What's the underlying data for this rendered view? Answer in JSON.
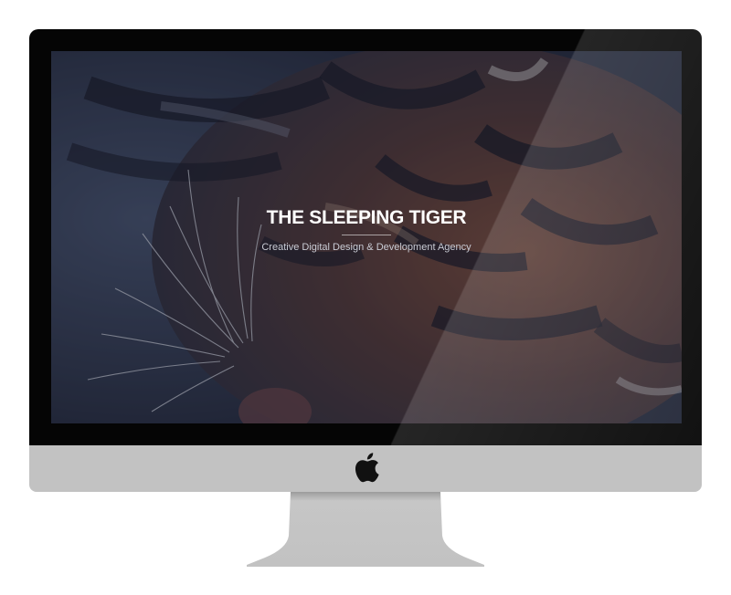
{
  "device": {
    "brand_icon": "apple-logo-icon",
    "colors": {
      "bezel": "#050505",
      "chin": "#c2c2c2",
      "stand": "#c4c4c4",
      "logo": "#111111"
    }
  },
  "website": {
    "hero": {
      "title": "THE SLEEPING TIGER",
      "subtitle": "Creative Digital Design & Development Agency"
    },
    "background_image": "tiger-photo"
  }
}
